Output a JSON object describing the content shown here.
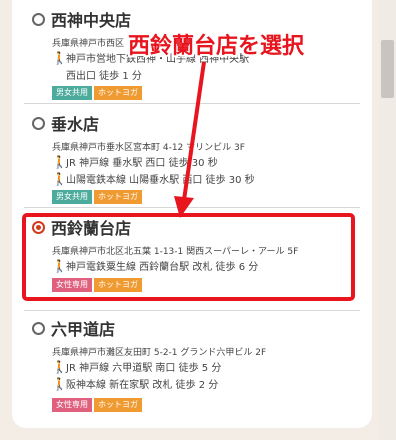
{
  "stores": [
    {
      "name": "西神中央店",
      "address": "兵庫県神戸市西区",
      "access": [
        "神戸市営地下鉄西神・山手線 西神中央駅",
        "西出口 徒歩 1 分"
      ],
      "tags": [
        "男女共用",
        "ホットヨガ"
      ],
      "selected": false
    },
    {
      "name": "垂水店",
      "address": "兵庫県神戸市垂水区宮本町 4-12 マリンビル 3F",
      "access": [
        "JR 神戸線 垂水駅 西口 徒歩 30 秒",
        "山陽電鉄本線 山陽垂水駅 西口 徒歩 30 秒"
      ],
      "tags": [
        "男女共用",
        "ホットヨガ"
      ],
      "selected": false
    },
    {
      "name": "西鈴蘭台店",
      "address": "兵庫県神戸市北区北五葉 1-13-1 関西スーパーレ・アール 5F",
      "access": [
        "神戸電鉄粟生線 西鈴蘭台駅 改札 徒歩 6 分"
      ],
      "tags": [
        "女性専用",
        "ホットヨガ"
      ],
      "selected": true
    },
    {
      "name": "六甲道店",
      "address": "兵庫県神戸市灘区友田町 5-2-1 グランド六甲ビル 2F",
      "access": [
        "JR 神戸線 六甲道駅 南口 徒歩 5 分",
        "阪神本線 新在家駅 改札 徒歩 2 分"
      ],
      "tags": [
        "女性専用",
        "ホットヨガ"
      ],
      "selected": false
    }
  ],
  "callout": "西鈴蘭台店を選択",
  "colors": {
    "accent": "#e8141e",
    "women_tag": "#e0617e",
    "mixed_tag": "#4cab9d",
    "hot_tag": "#f09a32"
  }
}
